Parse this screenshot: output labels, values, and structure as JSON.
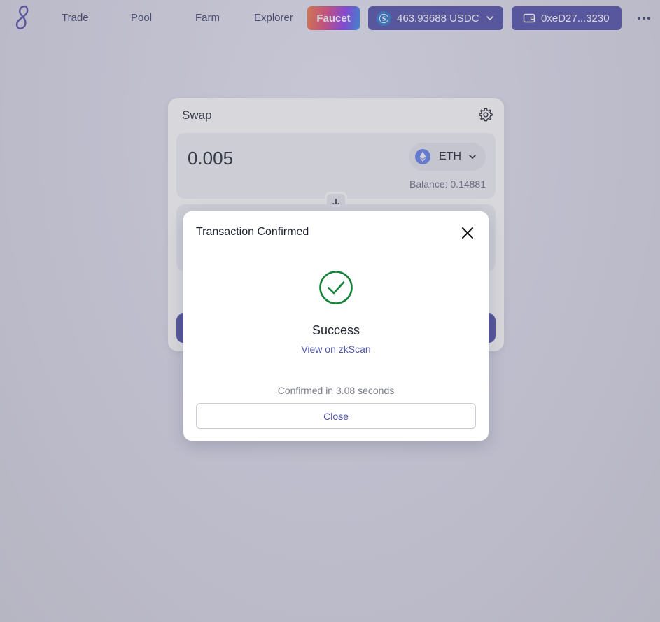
{
  "nav": {
    "links": [
      "Trade",
      "Pool",
      "Farm",
      "Explorer"
    ],
    "faucet_label": "Faucet",
    "balance": "463.93688 USDC",
    "wallet_address": "0xeD27...3230"
  },
  "swap": {
    "title": "Swap",
    "amount": "0.005",
    "token": "ETH",
    "balance_text": "Balance: 0.14881"
  },
  "modal": {
    "title": "Transaction Confirmed",
    "status": "Success",
    "link_text": "View on zkScan",
    "confirmed_text": "Confirmed in 3.08 seconds",
    "close_label": "Close"
  },
  "colors": {
    "primary": "#4f4ea8",
    "success": "#16833a",
    "usdc": "#2775ca",
    "eth": "#627eea"
  },
  "icons": {
    "logo": "eight-logo-icon",
    "usdc": "usdc-coin-icon",
    "wallet": "wallet-icon",
    "more": "more-dots-icon",
    "settings": "gear-icon",
    "eth": "eth-icon",
    "flip": "arrow-down-icon",
    "close": "close-icon",
    "success": "check-circle-icon"
  }
}
